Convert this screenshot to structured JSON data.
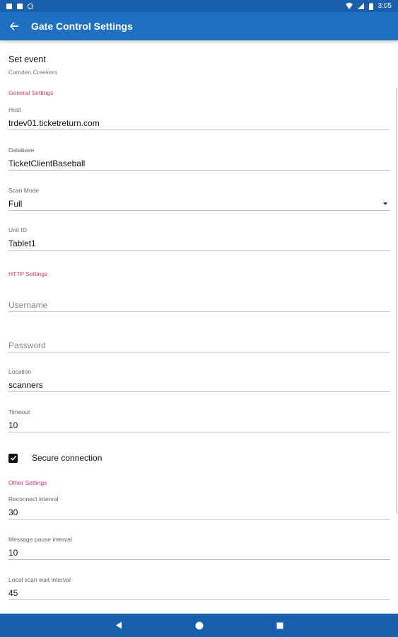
{
  "status_bar": {
    "time": "3:05",
    "left_icons": [
      "notification-icon",
      "sd-card-icon",
      "sync-icon"
    ],
    "right_icons": [
      "wifi-icon",
      "signal-icon",
      "battery-icon"
    ]
  },
  "app_bar": {
    "title": "Gate Control Settings",
    "back_icon": "arrow-left-icon",
    "color": "#1f6fc2"
  },
  "event": {
    "label": "Set event",
    "name": "Camden Creekers"
  },
  "sections": {
    "general": "General Settings",
    "http": "HTTP Settings",
    "other": "Other Settings"
  },
  "accent_color": "#e0326b",
  "fields": {
    "host": {
      "label": "Host",
      "value": "trdev01.ticketreturn.com"
    },
    "database": {
      "label": "Database",
      "value": "TicketClientBaseball"
    },
    "scan_mode": {
      "label": "Scan Mode",
      "value": "Full"
    },
    "unit_id": {
      "label": "Unit ID",
      "value": "Tablet1"
    },
    "username": {
      "placeholder": "Username"
    },
    "password": {
      "placeholder": "Password"
    },
    "location": {
      "label": "Location",
      "value": "scanners"
    },
    "timeout": {
      "label": "Timeout",
      "value": "10"
    },
    "reconnect_interval": {
      "label": "Reconnect interval",
      "value": "30"
    },
    "message_pause_interval": {
      "label": "Message pause interval",
      "value": "10"
    },
    "local_scan_wait_interval": {
      "label": "Local scan wait interval",
      "value": "45"
    }
  },
  "secure_connection": {
    "label": "Secure connection",
    "checked": true
  },
  "nav_bar": {
    "icons": [
      "back-triangle-icon",
      "home-circle-icon",
      "recents-square-icon"
    ]
  }
}
